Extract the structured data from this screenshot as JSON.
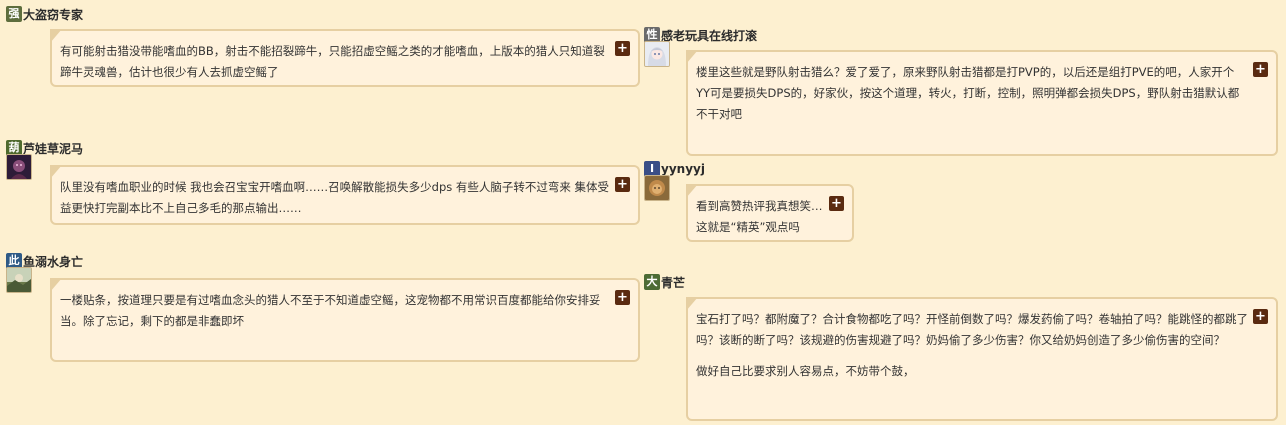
{
  "comments": [
    {
      "badge": "强",
      "badge_color": "#5e6d3d",
      "name": "大盗窃专家",
      "lines": [
        "有可能射击猎没带能嗜血的BB，射击不能招裂蹄牛，只能招虚空鳐之类的才能嗜血，上版本的猎人只知道裂蹄牛灵魂兽，估计也很少有人去抓虚空鳐了"
      ],
      "avatar_icon": "none"
    },
    {
      "badge": "性",
      "badge_color": "#6a6a6a",
      "name": "感老玩具在线打滚",
      "lines": [
        "楼里这些就是野队射击猎么？爱了爱了，原来野队射击猎都是打PVP的，以后还是组打PVE的吧，人家开个YY可是要损失DPS的，好家伙，按这个道理，转火，打断，控制，照明弹都会损失DPS，野队射击猎默认都不干对吧"
      ],
      "avatar_icon": "anime-girl-avatar"
    },
    {
      "badge": "葫",
      "badge_color": "#4f6a2d",
      "name": "芦娃草泥马",
      "lines": [
        "队里没有嗜血职业的时候 我也会召宝宝开嗜血啊……召唤解散能损失多少dps 有些人脑子转不过弯来 集体受益更快打完副本比不上自己多毛的那点输出……"
      ],
      "avatar_icon": "dark-character-avatar"
    },
    {
      "badge": "I",
      "badge_color": "#3a4e86",
      "name": "yynyyj",
      "lines": [
        "看到高赞热评我真想笑…",
        "这就是“精英”观点吗"
      ],
      "avatar_icon": "lion-avatar"
    },
    {
      "badge": "此",
      "badge_color": "#2f5a86",
      "name": "鱼溺水身亡",
      "lines": [
        "一楼贴条，按道理只要是有过嗜血念头的猎人不至于不知道虚空鳐，这宠物都不用常识百度都能给你安排妥当。除了忘记，剩下的都是非蠢即坏"
      ],
      "avatar_icon": "landscape-avatar"
    },
    {
      "badge": "大",
      "badge_color": "#4c6b35",
      "name": "青芒",
      "lines": [
        "宝石打了吗？都附魔了？合计食物都吃了吗？开怪前倒数了吗？爆发药偷了吗？卷轴拍了吗？能跳怪的都跳了吗？该断的断了吗？该规避的伤害规避了吗？奶妈偷了多少伤害？你又给奶妈创造了多少偷伤害的空间？",
        "",
        "做好自己比要求别人容易点，不妨带个鼓，"
      ],
      "avatar_icon": "none"
    }
  ],
  "ui": {
    "expand_label": "+"
  }
}
